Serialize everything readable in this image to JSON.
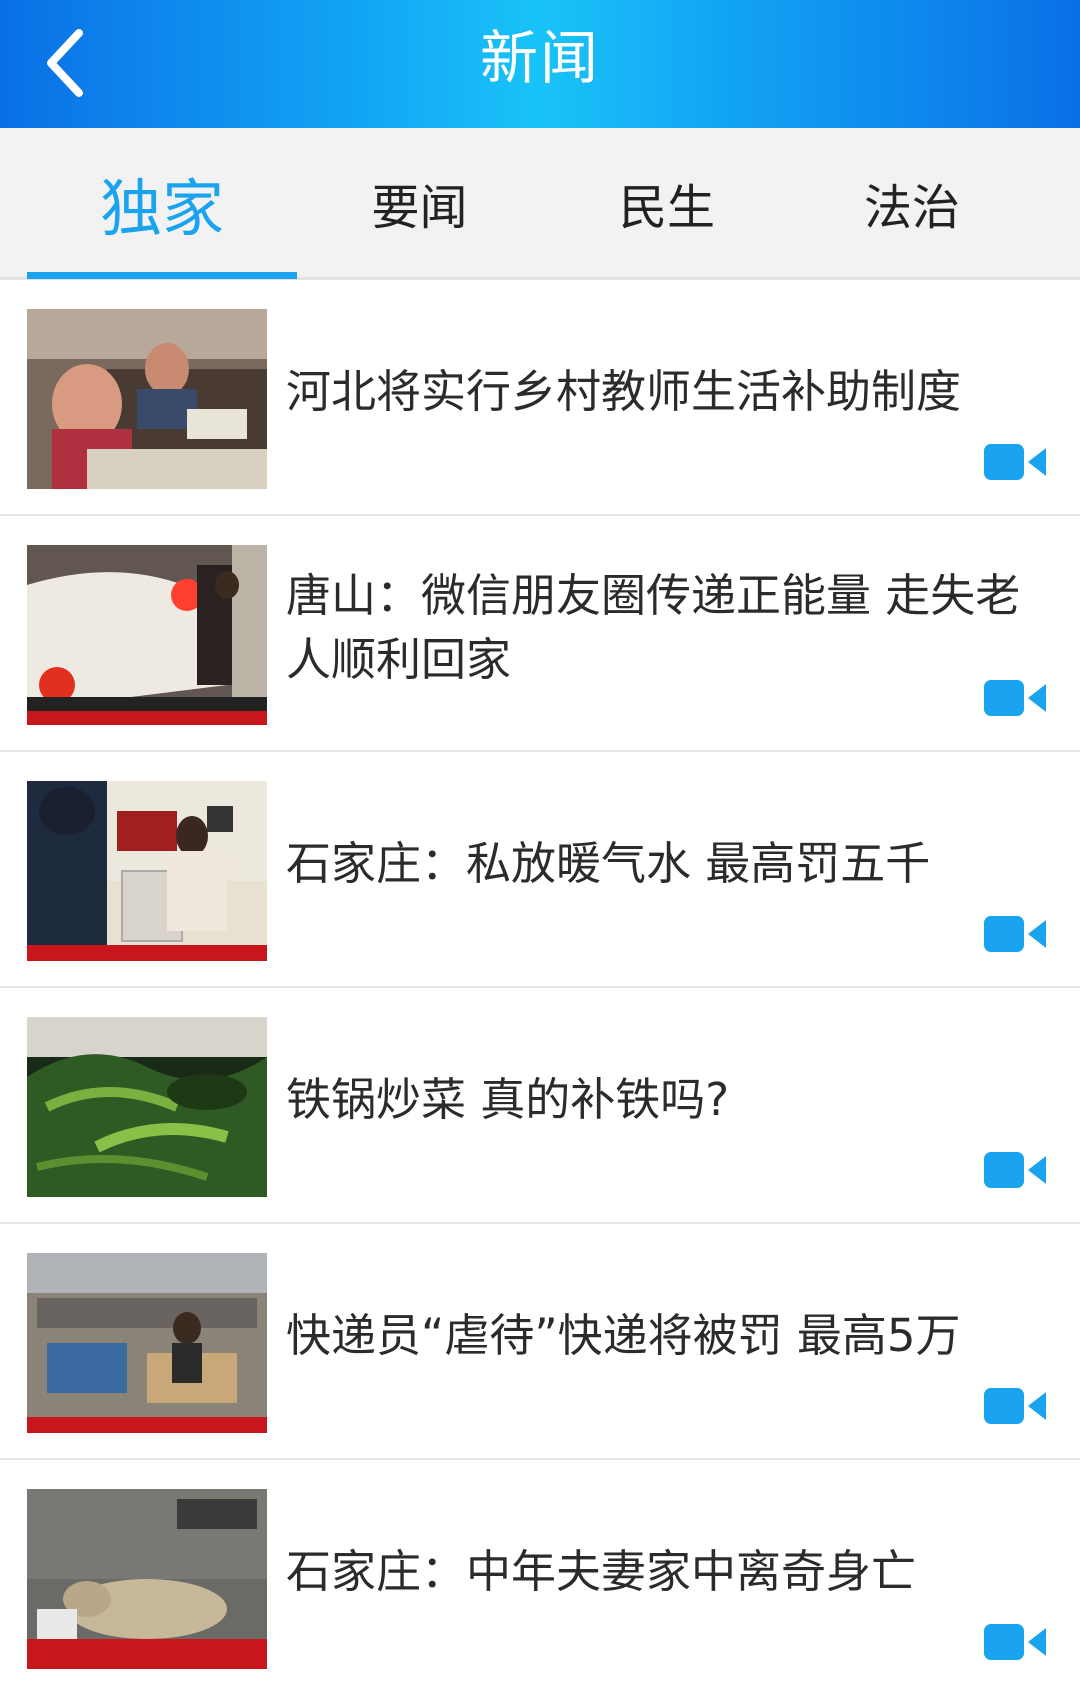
{
  "header": {
    "title": "新闻",
    "back_icon": "chevron-left-icon"
  },
  "tabs": [
    {
      "label": "独家",
      "active": true
    },
    {
      "label": "要闻",
      "active": false
    },
    {
      "label": "民生",
      "active": false
    },
    {
      "label": "法治",
      "active": false
    }
  ],
  "colors": {
    "accent": "#1aa3ee",
    "header_gradient": [
      "#0a6fe6",
      "#19c3f7"
    ],
    "text": "#2b2b2b"
  },
  "news": [
    {
      "title": "河北将实行乡村教师生活补助制度",
      "thumbnail": "classroom-students",
      "icon": "video-camera-icon"
    },
    {
      "title": "唐山：微信朋友圈传递正能量 走失老人顺利回家",
      "thumbnail": "car-at-night",
      "icon": "video-camera-icon"
    },
    {
      "title": "石家庄：私放暖气水 最高罚五千",
      "thumbnail": "radiator-room",
      "icon": "video-camera-icon"
    },
    {
      "title": "铁锅炒菜 真的补铁吗?",
      "thumbnail": "cooked-spinach",
      "icon": "video-camera-icon"
    },
    {
      "title": "快递员“虐待”快递将被罚 最高5万",
      "thumbnail": "parcel-warehouse",
      "icon": "video-camera-icon"
    },
    {
      "title": "石家庄：中年夫妻家中离奇身亡",
      "thumbnail": "dog-on-floor",
      "icon": "video-camera-icon"
    }
  ]
}
